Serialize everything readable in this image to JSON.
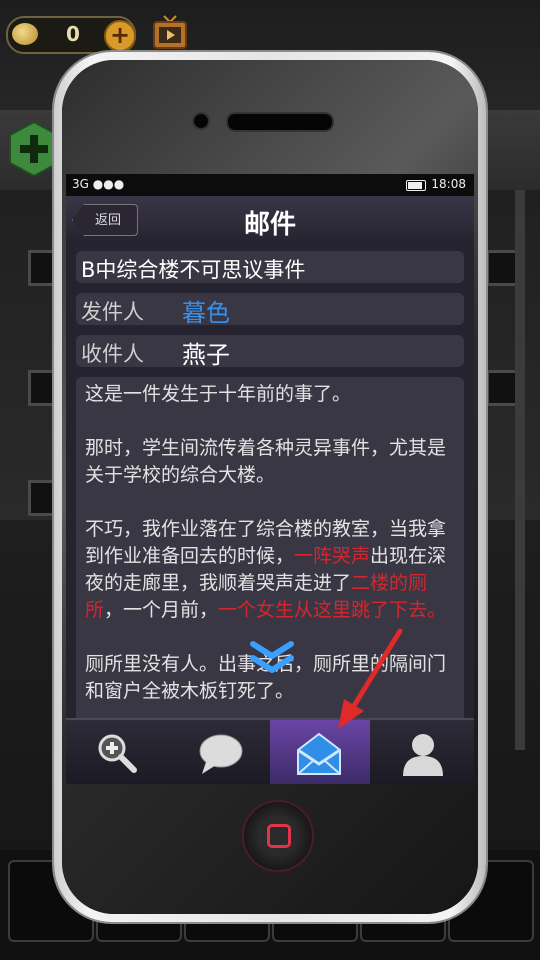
{
  "hud": {
    "coins": "0"
  },
  "phone": {
    "status": {
      "network": "3G ●●●",
      "time": "18:08"
    },
    "nav": {
      "back_label": "返回",
      "title": "邮件"
    },
    "mail": {
      "subject": "B中综合楼不可思议事件",
      "sender_label": "发件人",
      "sender_value": "暮色",
      "receiver_label": "收件人",
      "receiver_value": "燕子",
      "paragraphs": {
        "p1": "这是一件发生于十年前的事了。",
        "p2": "那时，学生间流传着各种灵异事件，尤其是关于学校的综合大楼。",
        "p3a": "不巧，我作业落在了综合楼的教室，当我拿到作业准备回去的时候，",
        "p3b": "一阵哭声",
        "p3c": "出现在深夜的走廊里，我顺着哭声走进了",
        "p3d": "二楼的厕所",
        "p3e": "，一个月前，",
        "p3f": "一个女生从这里跳了下去。",
        "p4": "厕所里没有人。出事之后，厕所里的隔间门和窗户全被木板钉死了。"
      }
    },
    "tabs": [
      "search-tab",
      "chat-tab",
      "mail-tab",
      "contacts-tab"
    ],
    "active_tab": "mail-tab"
  },
  "colors": {
    "sender_name": "#3b8fe6",
    "highlight": "#d6252e",
    "active_tab": "#6a45a6"
  }
}
